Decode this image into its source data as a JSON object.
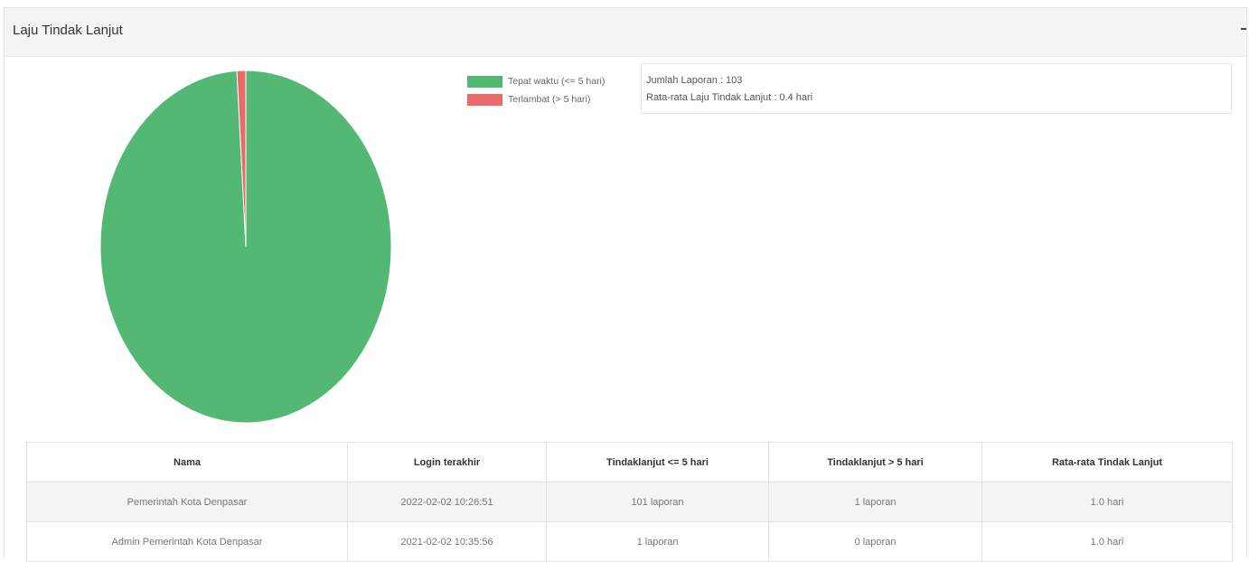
{
  "panel": {
    "title": "Laju Tindak Lanjut"
  },
  "chart_data": {
    "type": "pie",
    "slices": [
      {
        "label": "Tepat waktu (<= 5 hari)",
        "value": 101,
        "color": "#52b874"
      },
      {
        "label": "Terlambat (> 5 hari)",
        "value": 1,
        "color": "#e86a6a"
      }
    ]
  },
  "legend": [
    {
      "label": "Tepat waktu (<= 5 hari)",
      "color": "#52b874"
    },
    {
      "label": "Terlambat (> 5 hari)",
      "color": "#e86a6a"
    }
  ],
  "summary": {
    "total_reports": "Jumlah Laporan : 103",
    "average_rate": "Rata-rata Laju Tindak Lanjut : 0.4 hari"
  },
  "table": {
    "headers": [
      "Nama",
      "Login terakhir",
      "Tindaklanjut <= 5 hari",
      "Tindaklanjut > 5 hari",
      "Rata-rata Tindak Lanjut"
    ],
    "rows": [
      [
        "Pemerintah Kota Denpasar",
        "2022-02-02 10:26:51",
        "101 laporan",
        "1 laporan",
        "1.0 hari"
      ],
      [
        "Admin Pemerintah Kota Denpasar",
        "2021-02-02 10:35:56",
        "1 laporan",
        "0 laporan",
        "1.0 hari"
      ]
    ]
  }
}
